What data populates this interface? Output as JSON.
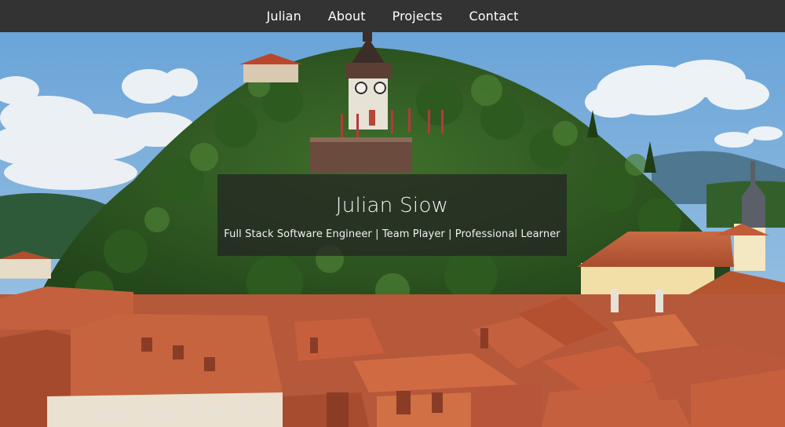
{
  "nav": {
    "items": [
      {
        "label": "Julian"
      },
      {
        "label": "About"
      },
      {
        "label": "Projects"
      },
      {
        "label": "Contact"
      }
    ]
  },
  "hero": {
    "name": "Julian Siow",
    "tagline": "Full Stack Software Engineer | Team Player | Professional Learner",
    "scene": "clock-tower-on-forested-hill-over-red-roofed-town"
  },
  "colors": {
    "navbar": "#333333",
    "nav_text": "#ffffff",
    "sky": "#7fb2dd",
    "forest": "#2f5a22",
    "roof": "#c4603d",
    "title_card": "rgba(35,35,35,0.72)"
  }
}
